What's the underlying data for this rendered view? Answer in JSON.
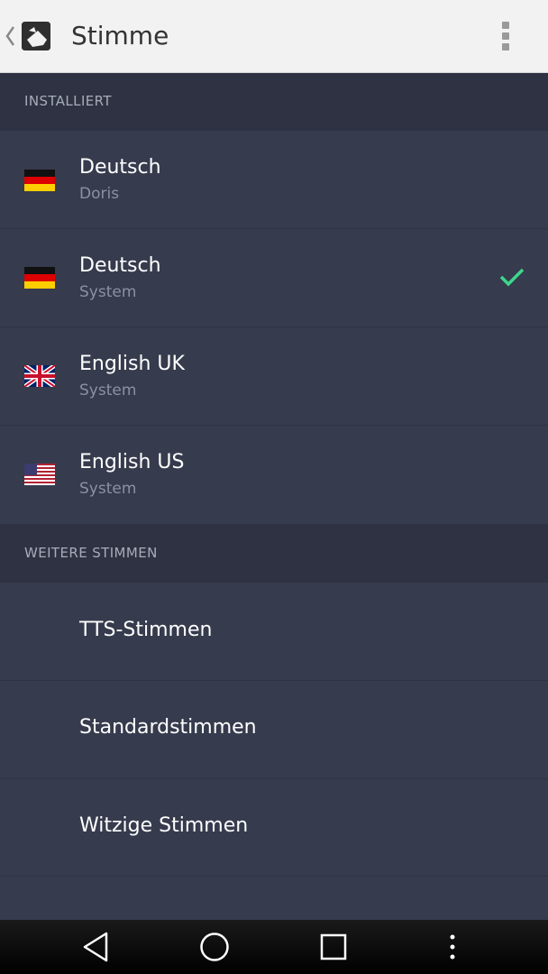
{
  "appbar": {
    "title": "Stimme",
    "back_icon": "chevron-left-icon",
    "logo_icon": "app-logo-icon",
    "menu_icon": "overflow-menu-icon"
  },
  "installed": {
    "header": "INSTALLIERT",
    "items": [
      {
        "title": "Deutsch",
        "subtitle": "Doris",
        "flag": "de-flag-icon",
        "selected": false
      },
      {
        "title": "Deutsch",
        "subtitle": "System",
        "flag": "de-flag-icon",
        "selected": true
      },
      {
        "title": "English UK",
        "subtitle": "System",
        "flag": "uk-flag-icon",
        "selected": false
      },
      {
        "title": "English US",
        "subtitle": "System",
        "flag": "us-flag-icon",
        "selected": false
      }
    ]
  },
  "more": {
    "header": "WEITERE STIMMEN",
    "items": [
      {
        "title": "TTS-Stimmen"
      },
      {
        "title": "Standardstimmen"
      },
      {
        "title": "Witzige Stimmen"
      }
    ]
  },
  "navbar": {
    "back": "nav-back-icon",
    "home": "nav-home-icon",
    "recents": "nav-recents-icon",
    "menu": "nav-menu-icon"
  },
  "colors": {
    "appbar_bg": "#f2f2f2",
    "section_bg": "#2e3242",
    "row_bg": "#363b4d",
    "check": "#3dd68c"
  }
}
